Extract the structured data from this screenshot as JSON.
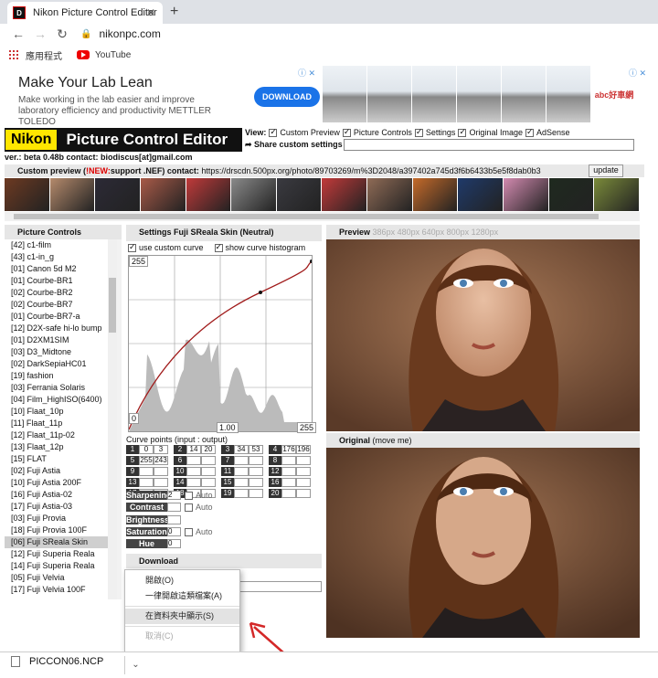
{
  "browser": {
    "tab_title": "Nikon Picture Control Editor",
    "tab_close": "✕",
    "new_tab": "+",
    "url": "nikonpc.com",
    "bookmarks": [
      "應用程式",
      "YouTube"
    ]
  },
  "ad": {
    "headline": "Make Your Lab Lean",
    "body": "Make working in the lab easier and improve laboratory efficiency and productivity METTLER TOLEDO",
    "cta": "DOWNLOAD",
    "close": "ⓘ ✕",
    "brand": "abc好車網"
  },
  "logo": {
    "nikon": "Nikon",
    "title": "Picture Control Editor"
  },
  "version_line": "ver.: beta 0.48b contact: biodiscus[at]gmail.com",
  "view": {
    "label": "View:",
    "options": [
      "Custom Preview",
      "Picture Controls",
      "Settings",
      "Original Image",
      "AdSense"
    ]
  },
  "share_label": "Share custom settings",
  "custom_preview": {
    "prefix": "Custom preview (",
    "new": "!NEW:",
    "mid": " support .NEF) contact:",
    "url": "https://drscdn.500px.org/photo/89703269/m%3D2048/a397402a745d3f6b6433b5e5f8dab0b3",
    "update": "update"
  },
  "thumbnail_colors": [
    "#6d3a22",
    "#b58a6c",
    "#2c2a36",
    "#a85a48",
    "#c03a3a",
    "#8a8a8a",
    "#3a3a40",
    "#c23a3a",
    "#8f6b56",
    "#c46a2a",
    "#1f3a6a",
    "#d38ab0",
    "#1f2a1f",
    "#7a8a3a"
  ],
  "picture_controls": {
    "title": "Picture Controls",
    "selected": "[06] Fuji SReala Skin",
    "items": [
      "[42] c1-film",
      "[43] c1-in_g",
      "[01] Canon 5d M2",
      "[01] Courbe-BR1",
      "[02] Courbe-BR2",
      "[02] Courbe-BR7",
      "[01] Courbe-BR7-a",
      "[12] D2X-safe hi-lo bump",
      "[01] D2XM1SIM",
      "[03] D3_Midtone",
      "[02] DarkSepiaHC01",
      "[19] fashion",
      "[03] Ferrania Solaris",
      "[04] Film_HighISO(6400)",
      "[10] Flaat_10p",
      "[11] Flaat_11p",
      "[12] Flaat_11p-02",
      "[13] Flaat_12p",
      "[15] FLAT",
      "[02] Fuji Astia",
      "[10] Fuji Astia 200F",
      "[16] Fuji Astia-02",
      "[17] Fuji Astia-03",
      "[03] Fuji Provia",
      "[18] Fuji Provia 100F",
      "[06] Fuji SReala Skin",
      "[12] Fuji Superia Reala",
      "[14] Fuji Superia Reala",
      "[05] Fuji Velvia",
      "[17] Fuji Velvia 100F"
    ]
  },
  "settings": {
    "title": "Settings Fuji SReala Skin (Neutral)",
    "use_curve": "use custom curve",
    "show_hist": "show curve histogram",
    "curve_labels": {
      "top_left": "255",
      "bottom_left": "0",
      "bottom_mid": "1.00",
      "bottom_right": "255"
    },
    "curve_points_title": "Curve points (input : output)",
    "curve_points": [
      {
        "i": "1",
        "a": "0",
        "b": "3"
      },
      {
        "i": "2",
        "a": "14",
        "b": "20"
      },
      {
        "i": "3",
        "a": "34",
        "b": "53"
      },
      {
        "i": "4",
        "a": "176",
        "b": "196"
      },
      {
        "i": "5",
        "a": "255",
        "b": "243"
      },
      {
        "i": "6",
        "a": "",
        "b": ""
      },
      {
        "i": "7",
        "a": "",
        "b": ""
      },
      {
        "i": "8",
        "a": "",
        "b": ""
      },
      {
        "i": "9",
        "a": "",
        "b": ""
      },
      {
        "i": "10",
        "a": "",
        "b": ""
      },
      {
        "i": "11",
        "a": "",
        "b": ""
      },
      {
        "i": "12",
        "a": "",
        "b": ""
      },
      {
        "i": "13",
        "a": "",
        "b": ""
      },
      {
        "i": "14",
        "a": "",
        "b": ""
      },
      {
        "i": "15",
        "a": "",
        "b": ""
      },
      {
        "i": "16",
        "a": "",
        "b": ""
      },
      {
        "i": "17",
        "a": "",
        "b": ""
      },
      {
        "i": "18",
        "a": "",
        "b": ""
      },
      {
        "i": "19",
        "a": "",
        "b": ""
      },
      {
        "i": "20",
        "a": "",
        "b": ""
      }
    ],
    "adjustments": [
      {
        "k": "Sharpening",
        "v": "2",
        "auto": "Auto"
      },
      {
        "k": "Contrast",
        "v": "",
        "auto": "Auto"
      },
      {
        "k": "Brightness",
        "v": "",
        "auto": ""
      },
      {
        "k": "Saturation",
        "v": "0",
        "auto": "Auto"
      },
      {
        "k": "Hue",
        "v": "0",
        "auto": ""
      }
    ],
    "download": "Download"
  },
  "preview": {
    "title": "Preview",
    "sizes": "386px 480px 640px 800px 1280px"
  },
  "original": {
    "title": "Original",
    "note": "(move me)"
  },
  "context_menu": {
    "items": [
      "開啟(O)",
      "一律開啟這類檔案(A)",
      "在資料夾中顯示(S)",
      "取消(C)"
    ]
  },
  "download_shelf": {
    "filename": "PICCON06.NCP",
    "arrow": "⌄"
  }
}
